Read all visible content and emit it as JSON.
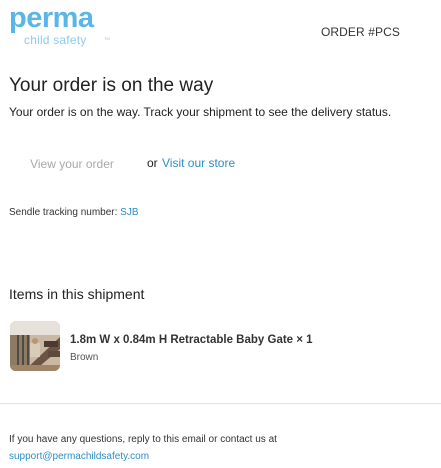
{
  "header": {
    "logo_text": "perma",
    "logo_subtext": "child safety",
    "logo_tm": "TM",
    "order_number": "ORDER #PCS"
  },
  "main": {
    "headline": "Your order is on the way",
    "subline": "Your order is on the way. Track your shipment to see the delivery status.",
    "view_order_label": "View your order",
    "or_label": "or",
    "visit_store_label": "Visit our store",
    "tracking_label": "Sendle tracking number: ",
    "tracking_number": "SJB"
  },
  "shipment": {
    "heading": "Items in this shipment",
    "items": [
      {
        "title": "1.8m W x 0.84m H Retractable Baby Gate × 1",
        "variant": "Brown"
      }
    ]
  },
  "footer": {
    "text": "If you have any questions, reply to this email or contact us at",
    "email": "support@permachildsafety.com"
  },
  "colors": {
    "brand": "#5ab6e6",
    "link": "#2d8fc4"
  }
}
